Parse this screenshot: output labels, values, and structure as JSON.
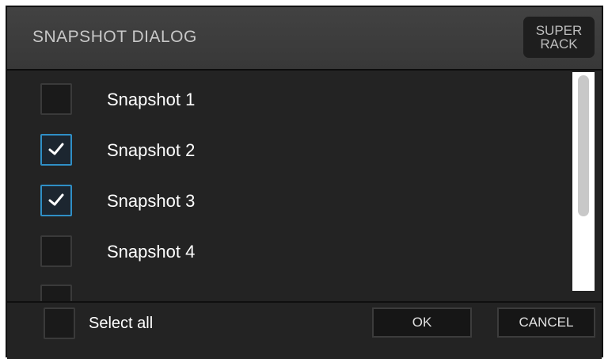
{
  "dialog": {
    "title": "SNAPSHOT DIALOG",
    "super_rack_line1": "SUPER",
    "super_rack_line2": "RACK"
  },
  "snapshots": [
    {
      "label": "Snapshot 1",
      "checked": false
    },
    {
      "label": "Snapshot 2",
      "checked": true
    },
    {
      "label": "Snapshot 3",
      "checked": true
    },
    {
      "label": "Snapshot 4",
      "checked": false
    },
    {
      "label": "",
      "checked": false
    }
  ],
  "footer": {
    "select_all_label": "Select all",
    "select_all_checked": false,
    "ok_label": "OK",
    "cancel_label": "CANCEL"
  },
  "colors": {
    "check_accent": "#2f8fc6",
    "background": "#232323",
    "header": "#3c3c3c"
  },
  "icons": {
    "checkmark": "check-icon"
  }
}
